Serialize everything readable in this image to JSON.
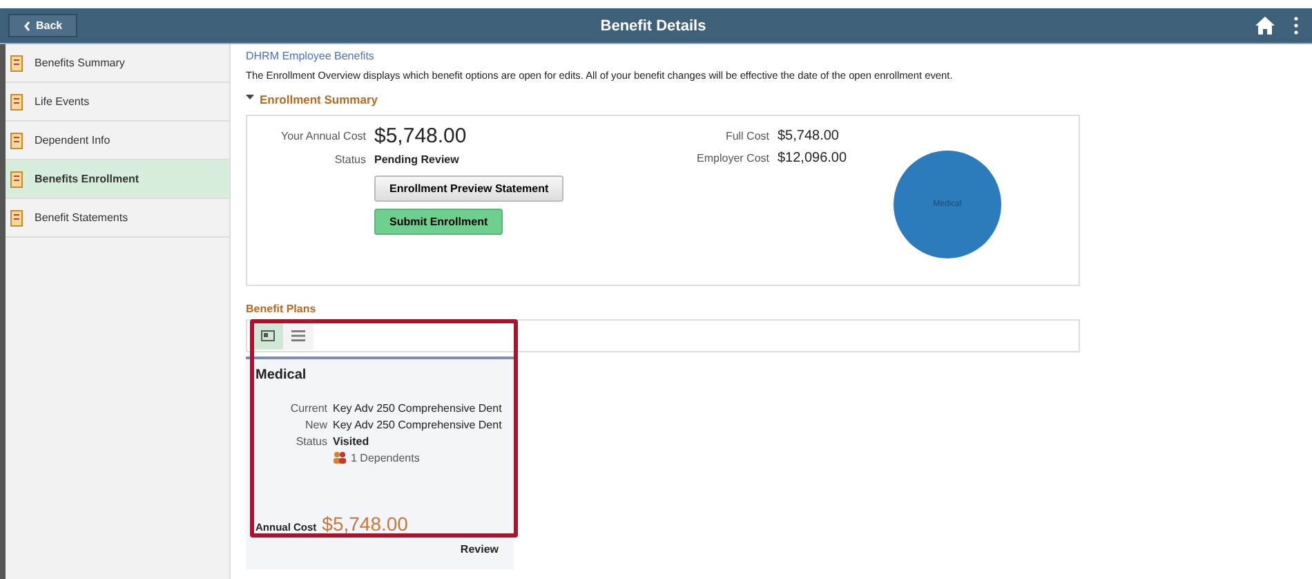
{
  "header": {
    "back_label": "Back",
    "title": "Benefit Details"
  },
  "sidebar": {
    "items": [
      {
        "label": "Benefits Summary",
        "selected": false
      },
      {
        "label": "Life Events",
        "selected": false
      },
      {
        "label": "Dependent Info",
        "selected": false
      },
      {
        "label": "Benefits Enrollment",
        "selected": true
      },
      {
        "label": "Benefit Statements",
        "selected": false
      }
    ]
  },
  "breadcrumb": "DHRM Employee Benefits",
  "description": "The Enrollment Overview displays which benefit options are open for edits. All of your benefit changes will be effective the date of the open enrollment event.",
  "enrollment_summary": {
    "heading": "Enrollment Summary",
    "expanded": true,
    "annual_cost_label": "Your Annual Cost",
    "annual_cost": "$5,748.00",
    "status_label": "Status",
    "status": "Pending Review",
    "buttons": [
      {
        "label": "Enrollment Preview Statement",
        "kind": "secondary"
      },
      {
        "label": "Submit Enrollment",
        "kind": "primary"
      }
    ],
    "full_cost_label": "Full Cost",
    "full_cost": "$5,748.00",
    "employer_cost_label": "Employer Cost",
    "employer_cost": "$12,096.00",
    "chart_label": "Medical"
  },
  "benefit_plans": {
    "heading": "Benefit Plans",
    "views": [
      {
        "kind": "tile",
        "selected": true
      },
      {
        "kind": "list",
        "selected": false
      }
    ],
    "cards": [
      {
        "title": "Medical",
        "fields": [
          {
            "label": "Current",
            "value": "Key Adv 250 Comprehensive Dent"
          },
          {
            "label": "New",
            "value": "Key Adv 250 Comprehensive Dent"
          },
          {
            "label": "Status",
            "value": "Visited"
          }
        ],
        "dependents": "1 Dependents",
        "cost_label": "Annual Cost",
        "cost": "$5,748.00",
        "action": "Review"
      }
    ]
  }
}
